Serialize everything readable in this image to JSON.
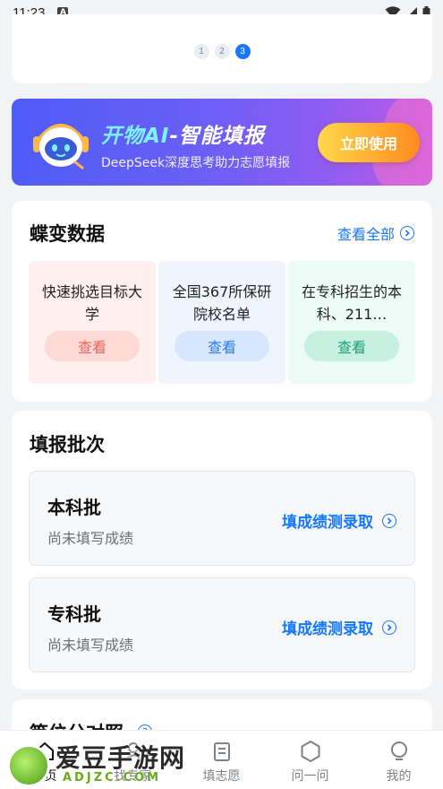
{
  "status_bar": {
    "time": "11:23",
    "notif_badge": "A"
  },
  "carousel": {
    "pages": [
      "1",
      "2",
      "3"
    ],
    "active_index": 2
  },
  "banner": {
    "title_prefix": "开物AI",
    "title_suffix": "-智能填报",
    "subtitle": "DeepSeek深度思考助力志愿填报",
    "cta": "立即使用"
  },
  "butterfly": {
    "title": "蝶变数据",
    "view_all": "查看全部",
    "tiles": [
      {
        "text": "快速挑选目标大学",
        "button": "查看"
      },
      {
        "text": "全国367所保研院校名单",
        "button": "查看"
      },
      {
        "text": "在专科招生的本科、211…",
        "button": "查看"
      }
    ]
  },
  "batches": {
    "title": "填报批次",
    "items": [
      {
        "name": "本科批",
        "hint": "尚未填写成绩",
        "action": "填成绩测录取"
      },
      {
        "name": "专科批",
        "hint": "尚未填写成绩",
        "action": "填成绩测录取"
      }
    ]
  },
  "next_section": {
    "title": "等位分对照"
  },
  "tabbar": {
    "items": [
      {
        "label": "首页",
        "icon": "home-icon"
      },
      {
        "label": "找专家",
        "icon": "expert-icon"
      },
      {
        "label": "填志愿",
        "icon": "form-icon"
      },
      {
        "label": "问一问",
        "icon": "hexagon-icon"
      },
      {
        "label": "我的",
        "icon": "profile-icon"
      }
    ],
    "active_index": 0
  },
  "watermark": {
    "text": "爱豆手游网",
    "url": "ADJZC.COM"
  },
  "colors": {
    "accent": "#1677ff",
    "cta_start": "#ffd84a",
    "cta_end": "#ff8a1f"
  }
}
